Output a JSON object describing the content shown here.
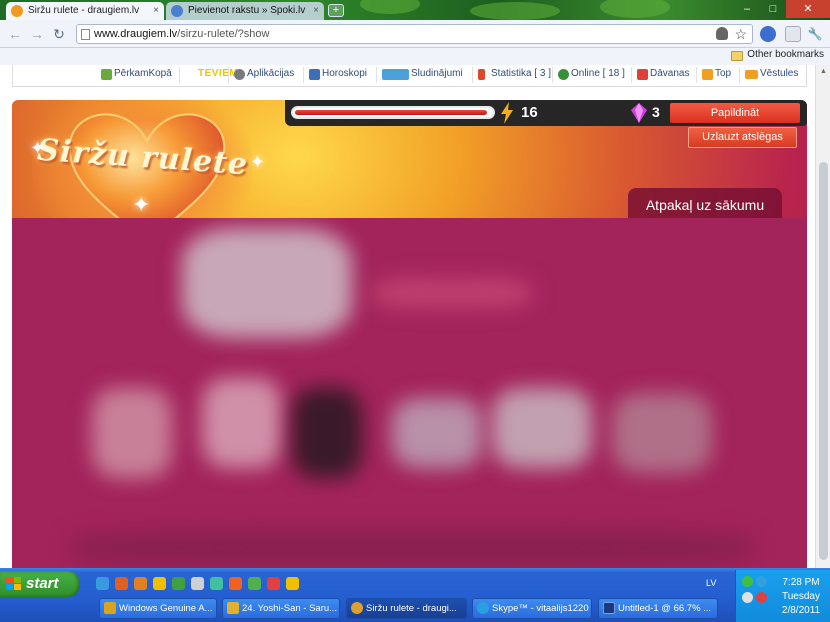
{
  "browser": {
    "tabs": [
      {
        "label": "Siržu rulete - draugiem.lv",
        "close": "×",
        "icon": "draugiem-favicon-icon",
        "color": "#f29a1f"
      },
      {
        "label": "Pievienot rakstu » Spoki.lv",
        "close": "×",
        "icon": "spoki-favicon-icon",
        "color": "#4a7fd1"
      }
    ],
    "new_tab": "+",
    "window_controls": {
      "minimize": "–",
      "maximize": "□",
      "close": "✕"
    },
    "url": {
      "domain": "www.draugiem.lv",
      "path": "/sirzu-rulete/?show"
    },
    "nav": {
      "back": "←",
      "forward": "→",
      "reload": "↻"
    },
    "bookmark_star": "☆",
    "wrench": "🔧",
    "other_bookmarks": "Other bookmarks"
  },
  "site_nav": {
    "items": [
      {
        "label": "PērkamKopā",
        "icon": "perkamkopa-icon",
        "color": "#6aaa3a"
      },
      {
        "label": "Aplikācijas",
        "icon": "apps-icon",
        "color": "#7a7a7a"
      },
      {
        "label": "Horoskopi",
        "icon": "horoscope-icon",
        "color": "#3c6fb8"
      },
      {
        "label": "Sludinājumi",
        "icon": "ads-icon",
        "color": "#4aa0d8"
      },
      {
        "label": "Statistika [ 3 ]",
        "icon": "stats-icon",
        "color": "#e0462b"
      },
      {
        "label": "Online [ 18 ]",
        "icon": "online-icon",
        "color": "#3a8f3a"
      },
      {
        "label": "Dāvanas",
        "icon": "gift-icon",
        "color": "#e04038"
      },
      {
        "label": "Top",
        "icon": "top-icon",
        "color": "#f0a020"
      },
      {
        "label": "Vēstules",
        "icon": "mail-icon",
        "color": "#f0a020"
      }
    ],
    "teviem_logo": "TEVIEM"
  },
  "game": {
    "logo": "Siržu rulete",
    "energy_fraction": 0.98,
    "energy": "16",
    "gems": "3",
    "topup_label": "Papildināt",
    "hack_label": "Uzlauzt atslēgas",
    "home_tab": "Atpakaļ uz sākumu"
  },
  "taskbar": {
    "start": "start",
    "language": "LV",
    "time": "7:28 PM",
    "day": "Tuesday",
    "date": "2/8/2011",
    "tasks": [
      {
        "label": "Windows Genuine A...",
        "icon": "windows-genuine-icon",
        "color": "#d9a520",
        "active": false
      },
      {
        "label": "24. Yoshi-San - Saru...",
        "icon": "messenger-icon",
        "color": "#e0b030",
        "active": false
      },
      {
        "label": "Siržu rulete - draugi...",
        "icon": "chrome-icon",
        "color": "#e0a030",
        "active": true
      },
      {
        "label": "Skype™ - vitaalijs1220",
        "icon": "skype-icon",
        "color": "#2aa0e0",
        "active": false
      },
      {
        "label": "Untitled-1 @ 66.7% ...",
        "icon": "photoshop-icon",
        "color": "#1a3a80",
        "active": false
      }
    ],
    "quick_launch_colors": [
      "#3a9ae0",
      "#e06020",
      "#e08020",
      "#f0c000",
      "#40a040",
      "#d0d0d0",
      "#40c0a0",
      "#f06020",
      "#50b050",
      "#e04040",
      "#f0c000"
    ]
  }
}
